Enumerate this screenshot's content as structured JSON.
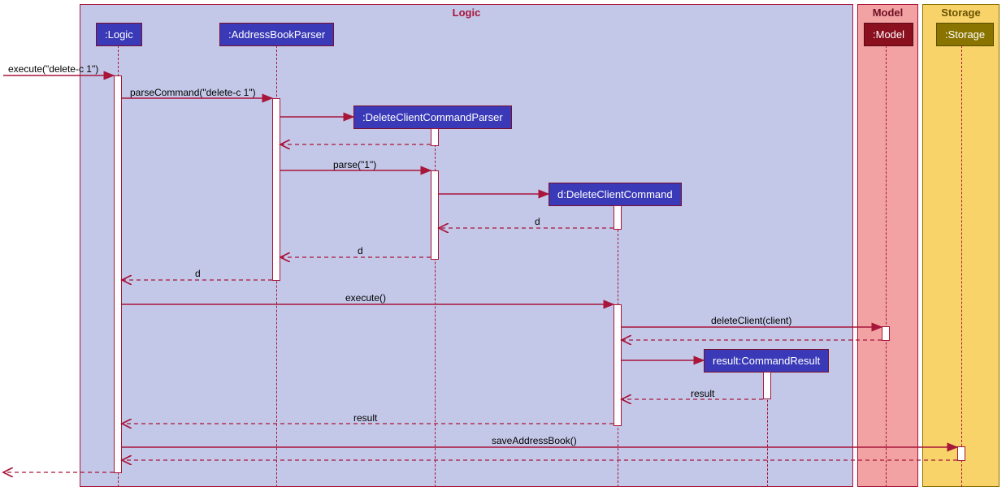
{
  "partitions": {
    "logic": {
      "title": "Logic"
    },
    "model": {
      "title": "Model"
    },
    "storage": {
      "title": "Storage"
    }
  },
  "participants": {
    "logic": ":Logic",
    "addressBookParser": ":AddressBookParser",
    "deleteClientCommandParser": ":DeleteClientCommandParser",
    "deleteClientCommand": "d:DeleteClientCommand",
    "commandResult": "result:CommandResult",
    "model": ":Model",
    "storage": ":Storage"
  },
  "messages": {
    "executeCmd": "execute(\"delete-c 1\")",
    "parseCommand": "parseCommand(\"delete-c 1\")",
    "parse": "parse(\"1\")",
    "return_d1": "d",
    "return_d2": "d",
    "return_d3": "d",
    "execute": "execute()",
    "deleteClient": "deleteClient(client)",
    "return_result1": "result",
    "return_result2": "result",
    "saveAddressBook": "saveAddressBook()"
  },
  "colors": {
    "accent": "#a8163a",
    "blueBox": "#3a3ab8",
    "redBox": "#8a0f1f",
    "yellowBox": "#8a7400"
  }
}
